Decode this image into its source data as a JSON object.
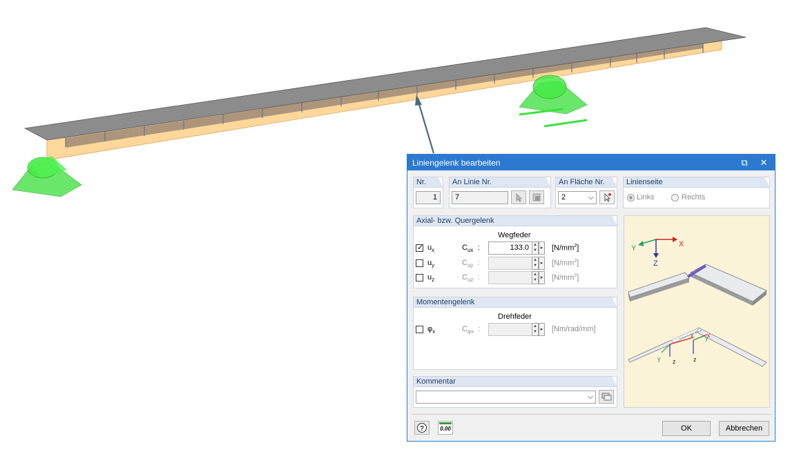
{
  "dialog": {
    "title": "Liniengelenk bearbeiten",
    "nr": {
      "label": "Nr.",
      "value": "1"
    },
    "an_linie": {
      "label": "An Linie Nr.",
      "value": "7"
    },
    "an_flaeche": {
      "label": "An Fläche Nr.",
      "value": "2"
    },
    "linienseite": {
      "label": "Linienseite",
      "options": [
        "Links",
        "Rechts"
      ],
      "selected": "Links"
    },
    "axial": {
      "label": "Axial- bzw. Quergelenk",
      "column_header": "Wegfeder",
      "rows": [
        {
          "checked": true,
          "dof": "u",
          "sub": "x",
          "coef": "C",
          "coef_sub": "ux",
          "value": "133.0",
          "unit": "[N/mm",
          "unit_sup": "2",
          "unit_end": "]"
        },
        {
          "checked": false,
          "dof": "u",
          "sub": "y",
          "coef": "C",
          "coef_sub": "uy",
          "value": "",
          "unit": "[N/mm",
          "unit_sup": "2",
          "unit_end": "]"
        },
        {
          "checked": false,
          "dof": "u",
          "sub": "z",
          "coef": "C",
          "coef_sub": "uz",
          "value": "",
          "unit": "[N/mm",
          "unit_sup": "2",
          "unit_end": "]"
        }
      ]
    },
    "moment": {
      "label": "Momentengelenk",
      "column_header": "Drehfeder",
      "row": {
        "checked": false,
        "dof": "φ",
        "sub": "x",
        "coef": "C",
        "coef_sub": "φx",
        "value": "",
        "unit": "[Nm/rad/mm]"
      }
    },
    "kommentar": {
      "label": "Kommentar",
      "value": ""
    },
    "illustration": {
      "axis_x": "X",
      "axis_y": "Y",
      "axis_z": "Z",
      "small_x": "x",
      "small_y": "y",
      "small_z": "z"
    },
    "buttons": {
      "ok": "OK",
      "cancel": "Abbrechen",
      "calc_icon_text": "0.00"
    }
  },
  "colors": {
    "accent": "#2b79d0",
    "hinge_green": "#3be03b",
    "beam_top": "#8c8c8c",
    "beam_side": "#ffd79a"
  }
}
